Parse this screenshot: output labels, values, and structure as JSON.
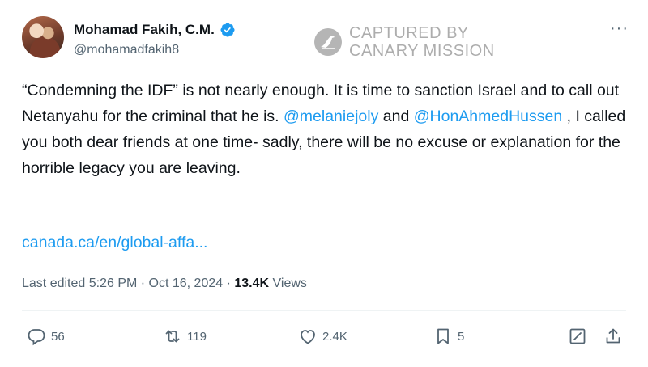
{
  "author": {
    "display_name": "Mohamad Fakih, C.M.",
    "handle": "@mohamadfakih8",
    "verified": true
  },
  "watermark": {
    "line1": "CAPTURED BY",
    "line2": "CANARY MISSION"
  },
  "tweet": {
    "text_part1": "“Condemning the IDF” is not nearly enough. It is time to sanction Israel and to call out Netanyahu for the criminal that he is. ",
    "mention1": "@melaniejoly",
    "text_part2": " and ",
    "mention2": "@HonAhmedHussen",
    "text_part3": " , I called you both dear friends at one time- sadly, there will be no excuse or explanation for the horrible legacy you are leaving.",
    "link": "canada.ca/en/global-affa..."
  },
  "meta": {
    "edited_label": "Last edited 5:26 PM · Oct 16, 2024 · ",
    "views_count": "13.4K",
    "views_label": " Views"
  },
  "actions": {
    "replies": "56",
    "reposts": "119",
    "likes": "2.4K",
    "bookmarks": "5"
  },
  "colors": {
    "accent": "#1d9bf0",
    "muted": "#536471",
    "text": "#0f1419"
  }
}
